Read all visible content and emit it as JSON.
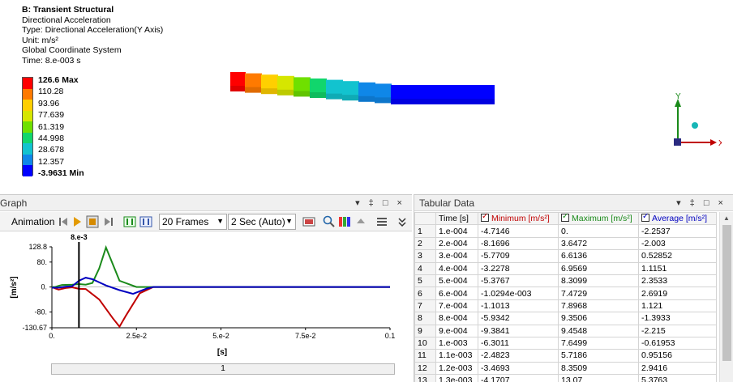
{
  "viewport": {
    "info": {
      "title": "B: Transient Structural",
      "result": "Directional Acceleration",
      "type": "Type: Directional Acceleration(Y Axis)",
      "unit": "Unit: m/s²",
      "system": "Global Coordinate System",
      "time": "Time: 8.e-003 s"
    },
    "legend": {
      "labels": [
        "126.6 Max",
        "110.28",
        "93.96",
        "77.639",
        "61.319",
        "44.998",
        "28.678",
        "12.357",
        "-3.9631 Min"
      ],
      "colors": [
        "#ff0000",
        "#ff7a00",
        "#ffcf00",
        "#d6e600",
        "#6fe000",
        "#11d66c",
        "#12c3cf",
        "#0f87e8",
        "#0000ff"
      ]
    },
    "triad": {
      "y": "Y",
      "x": "X"
    }
  },
  "graph": {
    "title": "Graph",
    "controls": "▾ ‡ □ ×",
    "animation_label": "Animation",
    "frames": "20 Frames",
    "duration": "2 Sec (Auto)",
    "scrollbar_label": "1",
    "chart_data": {
      "type": "line",
      "xlabel": "[s]",
      "ylabel": "[m/s²]",
      "xlim": [
        0,
        0.1
      ],
      "ylim": [
        -130.67,
        128.8
      ],
      "xticks": [
        0,
        0.025,
        0.05,
        0.075,
        0.1
      ],
      "xtick_labels": [
        "0.",
        "2.5e-2",
        "5.e-2",
        "7.5e-2",
        "0.1"
      ],
      "yticks": [
        128.8,
        80,
        0,
        -80,
        -130.67
      ],
      "ytick_labels": [
        "128.8",
        "80.",
        "0.",
        "-80.",
        "-130.67"
      ],
      "cursor_x": 0.008,
      "cursor_label": "8.e-3",
      "series": [
        {
          "name": "Minimum",
          "color": "#c00000",
          "x": [
            0,
            0.001,
            0.002,
            0.003,
            0.004,
            0.006,
            0.008,
            0.01,
            0.014,
            0.018,
            0.02,
            0.022,
            0.026,
            0.03,
            0.04,
            0.05,
            0.06,
            0.07,
            0.08,
            0.09,
            0.1
          ],
          "y": [
            0,
            -4.71,
            -8.17,
            -5.77,
            -3.23,
            -1.03,
            -5.93,
            -6.3,
            -40,
            -100,
            -127,
            -90,
            -20,
            0,
            0,
            0,
            0,
            0,
            0,
            0,
            0
          ]
        },
        {
          "name": "Maximum",
          "color": "#1a8a1a",
          "x": [
            0,
            0.001,
            0.002,
            0.003,
            0.004,
            0.006,
            0.008,
            0.01,
            0.012,
            0.014,
            0.016,
            0.02,
            0.025,
            0.03,
            0.04,
            0.05,
            0.06,
            0.07,
            0.08,
            0.09,
            0.1
          ],
          "y": [
            0,
            0,
            3.65,
            6.61,
            6.96,
            7.47,
            9.35,
            7.65,
            13.07,
            60,
            126.6,
            20,
            0,
            0,
            0,
            0,
            0,
            0,
            0,
            0,
            0
          ]
        },
        {
          "name": "Average",
          "color": "#0000c0",
          "x": [
            0,
            0.002,
            0.004,
            0.006,
            0.008,
            0.01,
            0.012,
            0.016,
            0.02,
            0.024,
            0.028,
            0.03,
            0.04,
            0.05,
            0.06,
            0.07,
            0.08,
            0.09,
            0.1
          ],
          "y": [
            -2.25,
            -2.0,
            1.12,
            2.69,
            20,
            30,
            25,
            5,
            -10,
            -22,
            -5,
            0,
            0,
            0,
            0,
            0,
            0,
            0,
            0
          ]
        }
      ]
    }
  },
  "tabular": {
    "title": "Tabular Data",
    "controls": "▾ ‡ □ ×",
    "columns": [
      "Time [s]",
      "Minimum [m/s²]",
      "Maximum [m/s²]",
      "Average [m/s²]"
    ],
    "column_colors": [
      "#000000",
      "#c00000",
      "#1a8a1a",
      "#0000c0"
    ],
    "rows": [
      [
        "1",
        "1.e-004",
        "-4.7146",
        "0.",
        "-2.2537"
      ],
      [
        "2",
        "2.e-004",
        "-8.1696",
        "3.6472",
        "-2.003"
      ],
      [
        "3",
        "3.e-004",
        "-5.7709",
        "6.6136",
        "0.52852"
      ],
      [
        "4",
        "4.e-004",
        "-3.2278",
        "6.9569",
        "1.1151"
      ],
      [
        "5",
        "5.e-004",
        "-5.3767",
        "8.3099",
        "2.3533"
      ],
      [
        "6",
        "6.e-004",
        "-1.0294e-003",
        "7.4729",
        "2.6919"
      ],
      [
        "7",
        "7.e-004",
        "-1.1013",
        "7.8968",
        "1.121"
      ],
      [
        "8",
        "8.e-004",
        "-5.9342",
        "9.3506",
        "-1.3933"
      ],
      [
        "9",
        "9.e-004",
        "-9.3841",
        "9.4548",
        "-2.215"
      ],
      [
        "10",
        "1.e-003",
        "-6.3011",
        "7.6499",
        "-0.61953"
      ],
      [
        "11",
        "1.1e-003",
        "-2.4823",
        "5.7186",
        "0.95156"
      ],
      [
        "12",
        "1.2e-003",
        "-3.4693",
        "8.3509",
        "2.9416"
      ],
      [
        "13",
        "1.3e-003",
        "-4.1707",
        "13.07",
        "5.3763"
      ]
    ]
  }
}
